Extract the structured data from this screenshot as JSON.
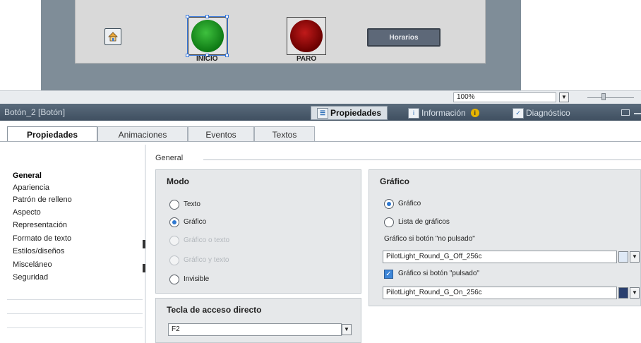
{
  "hmi": {
    "buttons": {
      "inicio_label": "INICIO",
      "paro_label": "PARO",
      "horarios_label": "Horarios"
    }
  },
  "zoom": {
    "value": "100%"
  },
  "inspector": {
    "title": "Botón_2 [Botón]",
    "top_tabs": {
      "propiedades": "Propiedades",
      "informacion": "Información",
      "diagnostico": "Diagnóstico"
    },
    "tabs": {
      "propiedades": "Propiedades",
      "animaciones": "Animaciones",
      "eventos": "Eventos",
      "textos": "Textos"
    },
    "nav": [
      "General",
      "Apariencia",
      "Patrón de relleno",
      "Aspecto",
      "Representación",
      "Formato de texto",
      "Estilos/diseños",
      "Misceláneo",
      "Seguridad"
    ],
    "section_title": "General",
    "modo": {
      "title": "Modo",
      "options": [
        "Texto",
        "Gráfico",
        "Gráfico o texto",
        "Gráfico y texto",
        "Invisible"
      ],
      "selected": "Gráfico"
    },
    "grafico": {
      "title": "Gráfico",
      "opt_grafico": "Gráfico",
      "opt_lista": "Lista de gráficos",
      "no_pulsado_label": "Gráfico si botón \"no pulsado\"",
      "no_pulsado_value": "PilotLight_Round_G_Off_256c",
      "pulsado_check_label": "Gráfico si botón \"pulsado\"",
      "pulsado_value": "PilotLight_Round_G_On_256c"
    },
    "tecla": {
      "title": "Tecla de acceso directo",
      "value": "F2"
    }
  },
  "colors": {
    "accent": "#2e78d0",
    "title_bar": "#4a5b6c",
    "lamp_on": "#1f9a25",
    "lamp_off": "#9a0a0a"
  }
}
